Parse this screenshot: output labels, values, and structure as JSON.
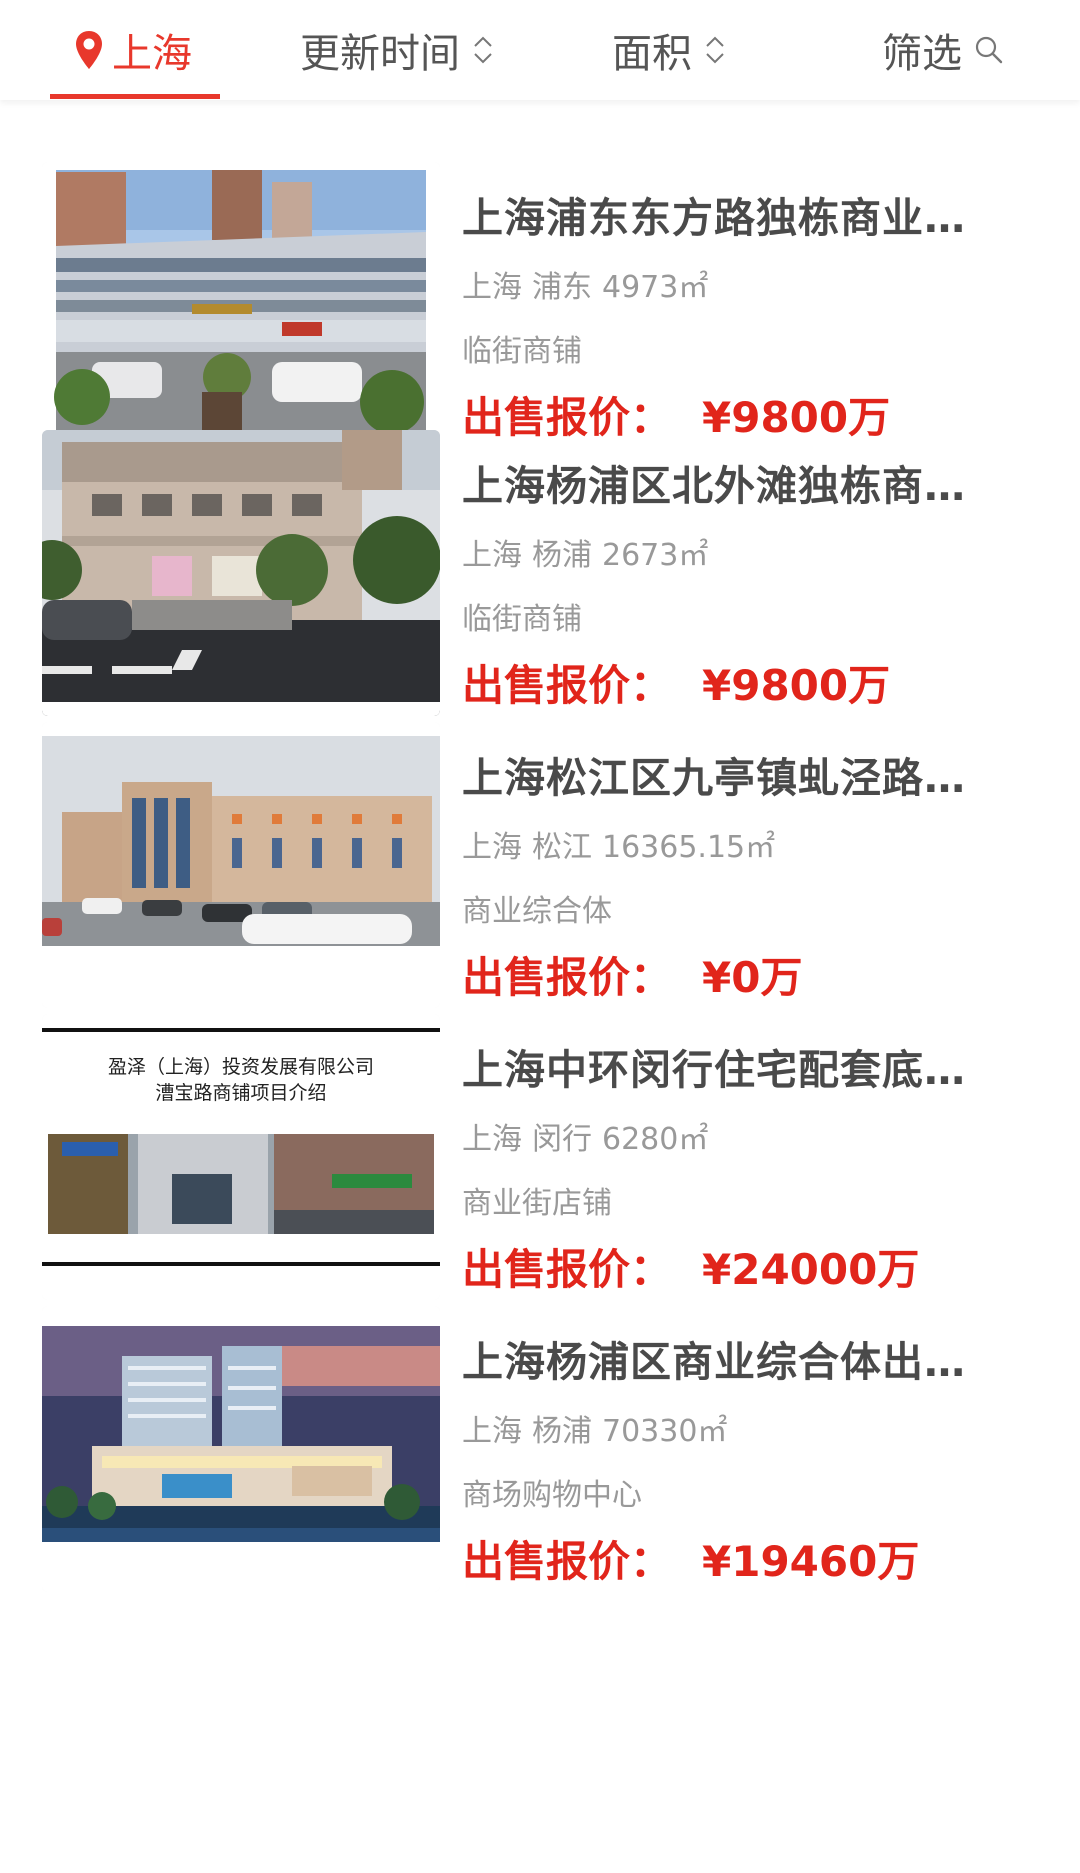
{
  "filter_bar": {
    "city": "上海",
    "sort_time": "更新时间",
    "sort_area": "面积",
    "filter": "筛选"
  },
  "colors": {
    "accent": "#e8382c",
    "price": "#e1251b",
    "title": "#4a4a4a",
    "meta": "#999999"
  },
  "listings": [
    {
      "title": "上海浦东东方路独栋商业楼出售",
      "title_display": "上海浦东东方路独栋商业…",
      "city": "上海",
      "district": "浦东",
      "area": "4973㎡",
      "category": "临街商铺",
      "price_label": "出售报价：",
      "price": "¥9800万",
      "image_icon": "office-building-photo"
    },
    {
      "title": "上海杨浦区北外滩独栋商业楼",
      "title_display": "上海杨浦区北外滩独栋商…",
      "city": "上海",
      "district": "杨浦",
      "area": "2673㎡",
      "category": "临街商铺",
      "price_label": "出售报价：",
      "price": "¥9800万",
      "image_icon": "street-building-photo"
    },
    {
      "title": "上海松江区九亭镇虬泾路商业",
      "title_display": "上海松江区九亭镇虬泾路…",
      "city": "上海",
      "district": "松江",
      "area": "16365.15㎡",
      "category": "商业综合体",
      "price_label": "出售报价：",
      "price": "¥0万",
      "image_icon": "hotel-building-photo"
    },
    {
      "title": "上海中环闵行住宅配套底商",
      "title_display": "上海中环闵行住宅配套底…",
      "city": "上海",
      "district": "闵行",
      "area": "6280㎡",
      "category": "商业街店铺",
      "price_label": "出售报价：",
      "price": "¥24000万",
      "image_icon": "presentation-slide-photo",
      "image_caption_line1": "盈泽（上海）投资发展有限公司",
      "image_caption_line2": "漕宝路商铺项目介绍"
    },
    {
      "title": "上海杨浦区商业综合体出售",
      "title_display": "上海杨浦区商业综合体出…",
      "city": "上海",
      "district": "杨浦",
      "area": "70330㎡",
      "category": "商场购物中心",
      "price_label": "出售报价：",
      "price": "¥19460万",
      "image_icon": "shopping-mall-render-photo"
    }
  ]
}
